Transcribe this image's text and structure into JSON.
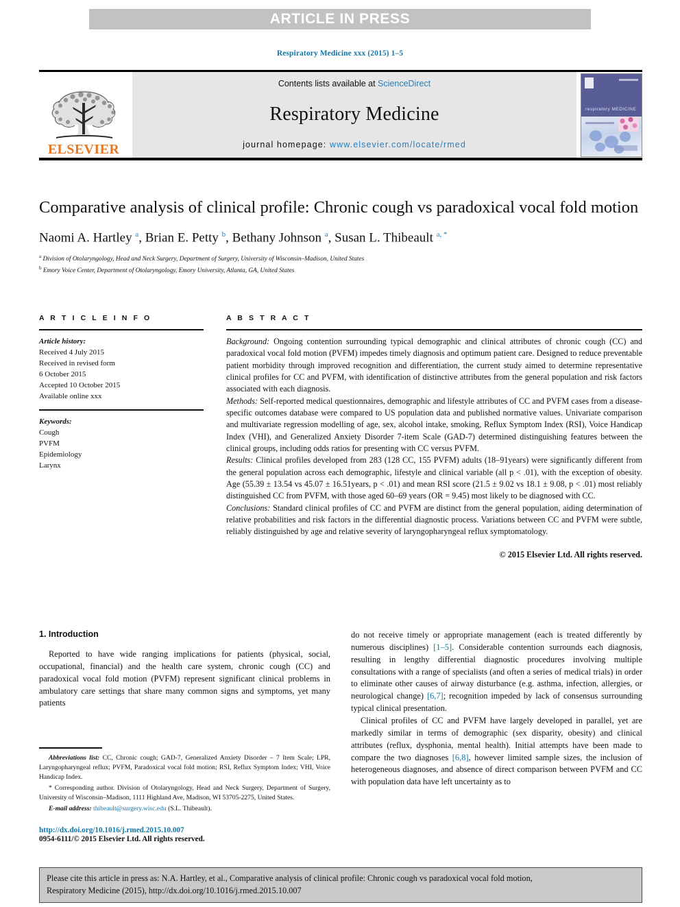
{
  "banner": {
    "label": "ARTICLE IN PRESS"
  },
  "running_head": "Respiratory Medicine xxx (2015) 1–5",
  "masthead": {
    "contents_prefix": "Contents lists available at ",
    "sciencedirect": "ScienceDirect",
    "journal_name": "Respiratory Medicine",
    "homepage_prefix": "journal homepage: ",
    "homepage_url": "www.elsevier.com/locate/rmed",
    "publisher": "ELSEVIER",
    "cover_title": "respiratory MEDICINE",
    "colors": {
      "link": "#2a7fb8",
      "elsevier_orange": "#e87722",
      "banner_gray": "#c2c2c2",
      "panel_gray": "#e6e6e6"
    }
  },
  "article": {
    "title": "Comparative analysis of clinical profile: Chronic cough vs paradoxical vocal fold motion",
    "authors": "Naomi A. Hartley a, Brian E. Petty b, Bethany Johnson a, Susan L. Thibeault a, *",
    "affiliation_a": "Division of Otolaryngology, Head and Neck Surgery, Department of Surgery, University of Wisconsin–Madison, United States",
    "affiliation_b": "Emory Voice Center, Department of Otolaryngology, Emory University, Atlanta, GA, United States"
  },
  "info": {
    "heading": "A R T I C L E   I N F O",
    "history_label": "Article history:",
    "history": [
      "Received 4 July 2015",
      "Received in revised form",
      "6 October 2015",
      "Accepted 10 October 2015",
      "Available online xxx"
    ],
    "keywords_label": "Keywords:",
    "keywords": [
      "Cough",
      "PVFM",
      "Epidemiology",
      "Larynx"
    ]
  },
  "abstract": {
    "heading": "A B S T R A C T",
    "background_label": "Background:",
    "background": " Ongoing contention surrounding typical demographic and clinical attributes of chronic cough (CC) and paradoxical vocal fold motion (PVFM) impedes timely diagnosis and optimum patient care. Designed to reduce preventable patient morbidity through improved recognition and differentiation, the current study aimed to determine representative clinical profiles for CC and PVFM, with identification of distinctive attributes from the general population and risk factors associated with each diagnosis.",
    "methods_label": "Methods:",
    "methods": " Self-reported medical questionnaires, demographic and lifestyle attributes of CC and PVFM cases from a disease-specific outcomes database were compared to US population data and published normative values. Univariate comparison and multivariate regression modelling of age, sex, alcohol intake, smoking, Reflux Symptom Index (RSI), Voice Handicap Index (VHI), and Generalized Anxiety Disorder 7-item Scale (GAD-7) determined distinguishing features between the clinical groups, including odds ratios for presenting with CC versus PVFM.",
    "results_label": "Results:",
    "results": " Clinical profiles developed from 283 (128 CC, 155 PVFM) adults (18–91years) were significantly different from the general population across each demographic, lifestyle and clinical variable (all p < .01), with the exception of obesity. Age (55.39 ± 13.54 vs 45.07 ± 16.51years, p < .01) and mean RSI score (21.5 ± 9.02 vs 18.1 ± 9.08, p < .01) most reliably distinguished CC from PVFM, with those aged 60–69 years (OR = 9.45) most likely to be diagnosed with CC.",
    "conclusions_label": "Conclusions:",
    "conclusions": " Standard clinical profiles of CC and PVFM are distinct from the general population, aiding determination of relative probabilities and risk factors in the differential diagnostic process. Variations between CC and PVFM were subtle, reliably distinguished by age and relative severity of laryngopharyngeal reflux symptomatology.",
    "copyright": "© 2015 Elsevier Ltd. All rights reserved."
  },
  "introduction": {
    "heading": "1. Introduction",
    "para1": "Reported to have wide ranging implications for patients (physical, social, occupational, financial) and the health care system, chronic cough (CC) and paradoxical vocal fold motion (PVFM) represent significant clinical problems in ambulatory care settings that share many common signs and symptoms, yet many patients",
    "right_para1_a": "do not receive timely or appropriate management (each is treated differently by numerous disciplines) ",
    "right_ref1": "[1–5]",
    "right_para1_b": ". Considerable contention surrounds each diagnosis, resulting in lengthy differential diagnostic procedures involving multiple consultations with a range of specialists (and often a series of medical trials) in order to eliminate other causes of airway disturbance (e.g. asthma, infection, allergies, or neurological change) ",
    "right_ref2": "[6,7]",
    "right_para1_c": "; recognition impeded by lack of consensus surrounding typical clinical presentation.",
    "right_para2_a": "Clinical profiles of CC and PVFM have largely developed in parallel, yet are markedly similar in terms of demographic (sex disparity, obesity) and clinical attributes (reflux, dysphonia, mental health). Initial attempts have been made to compare the two diagnoses ",
    "right_ref3": "[6,8]",
    "right_para2_b": ", however limited sample sizes, the inclusion of heterogeneous diagnoses, and absence of direct comparison between PVFM and CC with population data have left uncertainty as to"
  },
  "footnotes": {
    "abbrev_label": "Abbreviations list:",
    "abbrev_text": " CC, Chronic cough; GAD-7, Generalized Anxiety Disorder – 7 Item Scale; LPR, Laryngopharyngeal reflux; PVFM, Paradoxical vocal fold motion; RSI, Reflux Symptom Index; VHI, Voice Handicap Index.",
    "corresponding": "* Corresponding author. Division of Otolaryngology, Head and Neck Surgery, Department of Surgery, University of Wisconsin–Madison, 1111 Highland Ave, Madison, WI 53705-2275, United States.",
    "email_label": "E-mail address:",
    "email": "thibeault@surgery.wisc.edu",
    "email_suffix": " (S.L. Thibeault).",
    "doi": "http://dx.doi.org/10.1016/j.rmed.2015.10.007",
    "issn": "0954-6111/© 2015 Elsevier Ltd. All rights reserved."
  },
  "citation": {
    "line1": "Please cite this article in press as: N.A. Hartley, et al., Comparative analysis of clinical profile: Chronic cough vs paradoxical vocal fold motion,",
    "line2": "Respiratory Medicine (2015), http://dx.doi.org/10.1016/j.rmed.2015.10.007"
  }
}
